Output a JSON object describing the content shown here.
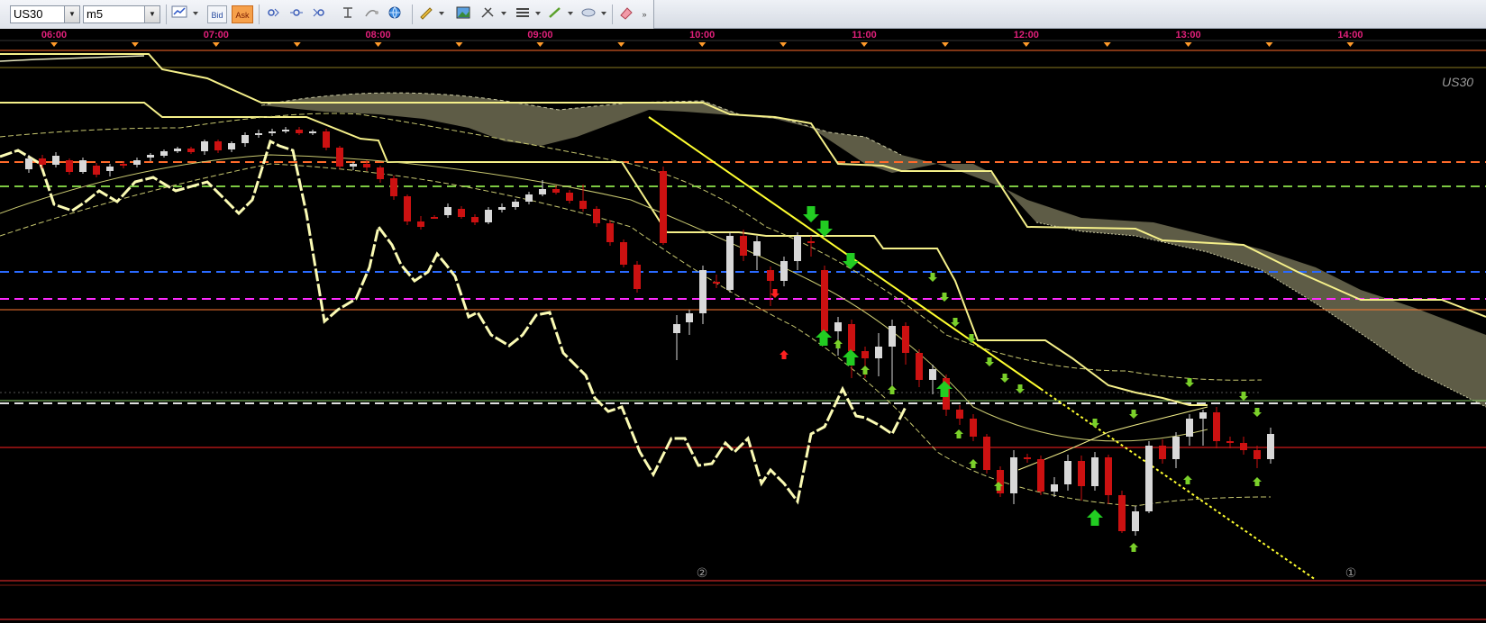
{
  "toolbar": {
    "symbol": "US30",
    "timeframe": "m5",
    "bid_label": "Bid",
    "ask_label": "Ask",
    "icons": [
      "line-chart-icon",
      "bid-button",
      "ask-button",
      "crosshair-left-icon",
      "crosshair-center-icon",
      "crosshair-right-icon",
      "pin-icon",
      "compass-icon",
      "globe-icon",
      "pencil-icon",
      "image-icon",
      "tools-icon",
      "lines-icon",
      "brush-icon",
      "shape-icon",
      "eraser-icon",
      "more-icon"
    ]
  },
  "chart_data": {
    "type": "candlestick",
    "symbol_watermark": "US30",
    "x_tick_labels": [
      "06:00",
      "07:00",
      "08:00",
      "09:00",
      "10:00",
      "11:00",
      "12:00",
      "13:00",
      "14:00"
    ],
    "bottom_markers": [
      "②",
      "①"
    ],
    "colors": {
      "background": "#000000",
      "time_label": "#e0207a",
      "bull_candle": "#d8d8d8",
      "bear_candle": "#cc1111",
      "trendline": "#ffff30",
      "cloud": "#6e6c52",
      "level_orange": "#ff6a2a",
      "level_green": "#7cc842",
      "level_blue": "#2a6aff",
      "level_magenta": "#ff2aff",
      "level_red": "#ff2020",
      "signal_up": "#22cc22",
      "signal_down": "#22cc22",
      "signal_red": "#ff2020"
    },
    "candles": [
      {
        "o": 188,
        "c": 176,
        "h": 172,
        "l": 192
      },
      {
        "o": 176,
        "c": 183,
        "h": 172,
        "l": 187
      },
      {
        "o": 183,
        "c": 173,
        "h": 169,
        "l": 186
      },
      {
        "o": 178,
        "c": 191,
        "h": 176,
        "l": 194
      },
      {
        "o": 191,
        "c": 178,
        "h": 175,
        "l": 193
      },
      {
        "o": 184,
        "c": 194,
        "h": 181,
        "l": 197
      },
      {
        "o": 190,
        "c": 185,
        "h": 182,
        "l": 196
      },
      {
        "o": 182,
        "c": 184,
        "h": 179,
        "l": 187
      },
      {
        "o": 183,
        "c": 178,
        "h": 175,
        "l": 186
      },
      {
        "o": 175,
        "c": 172,
        "h": 170,
        "l": 179
      },
      {
        "o": 173,
        "c": 168,
        "h": 166,
        "l": 175
      },
      {
        "o": 168,
        "c": 165,
        "h": 163,
        "l": 170
      },
      {
        "o": 165,
        "c": 169,
        "h": 163,
        "l": 171
      },
      {
        "o": 168,
        "c": 157,
        "h": 155,
        "l": 172
      },
      {
        "o": 157,
        "c": 167,
        "h": 155,
        "l": 170
      },
      {
        "o": 166,
        "c": 159,
        "h": 157,
        "l": 169
      },
      {
        "o": 159,
        "c": 150,
        "h": 147,
        "l": 163
      },
      {
        "o": 150,
        "c": 148,
        "h": 144,
        "l": 153
      },
      {
        "o": 148,
        "c": 146,
        "h": 143,
        "l": 151
      },
      {
        "o": 146,
        "c": 144,
        "h": 141,
        "l": 148
      },
      {
        "o": 144,
        "c": 148,
        "h": 141,
        "l": 150
      },
      {
        "o": 148,
        "c": 146,
        "h": 144,
        "l": 150
      },
      {
        "o": 146,
        "c": 164,
        "h": 143,
        "l": 167
      },
      {
        "o": 164,
        "c": 185,
        "h": 162,
        "l": 188
      },
      {
        "o": 185,
        "c": 182,
        "h": 180,
        "l": 189
      },
      {
        "o": 182,
        "c": 186,
        "h": 178,
        "l": 190
      },
      {
        "o": 186,
        "c": 199,
        "h": 184,
        "l": 203
      },
      {
        "o": 198,
        "c": 218,
        "h": 195,
        "l": 222
      },
      {
        "o": 218,
        "c": 246,
        "h": 216,
        "l": 250
      },
      {
        "o": 246,
        "c": 252,
        "h": 240,
        "l": 255
      },
      {
        "o": 241,
        "c": 241,
        "h": 239,
        "l": 243
      },
      {
        "o": 239,
        "c": 230,
        "h": 226,
        "l": 242
      },
      {
        "o": 232,
        "c": 241,
        "h": 229,
        "l": 243
      },
      {
        "o": 241,
        "c": 247,
        "h": 238,
        "l": 250
      },
      {
        "o": 247,
        "c": 233,
        "h": 230,
        "l": 249
      },
      {
        "o": 233,
        "c": 230,
        "h": 226,
        "l": 236
      },
      {
        "o": 230,
        "c": 224,
        "h": 221,
        "l": 233
      },
      {
        "o": 224,
        "c": 216,
        "h": 213,
        "l": 227
      },
      {
        "o": 216,
        "c": 210,
        "h": 200,
        "l": 218
      },
      {
        "o": 210,
        "c": 214,
        "h": 206,
        "l": 216
      },
      {
        "o": 214,
        "c": 223,
        "h": 211,
        "l": 226
      },
      {
        "o": 223,
        "c": 232,
        "h": 205,
        "l": 235
      },
      {
        "o": 232,
        "c": 248,
        "h": 229,
        "l": 252
      },
      {
        "o": 248,
        "c": 269,
        "h": 245,
        "l": 273
      },
      {
        "o": 269,
        "c": 294,
        "h": 266,
        "l": 297
      },
      {
        "o": 294,
        "c": 321,
        "h": 290,
        "l": 325
      }
    ],
    "y_levels": [
      {
        "name": "orange-dash",
        "value": 180
      },
      {
        "name": "green-dash",
        "value": 207
      },
      {
        "name": "blue-dash",
        "value": 302
      },
      {
        "name": "magenta-dash",
        "value": 332
      },
      {
        "name": "orange-solid",
        "value": 344
      },
      {
        "name": "white-dash",
        "value": 448
      },
      {
        "name": "red-solid",
        "value": 497
      }
    ]
  }
}
